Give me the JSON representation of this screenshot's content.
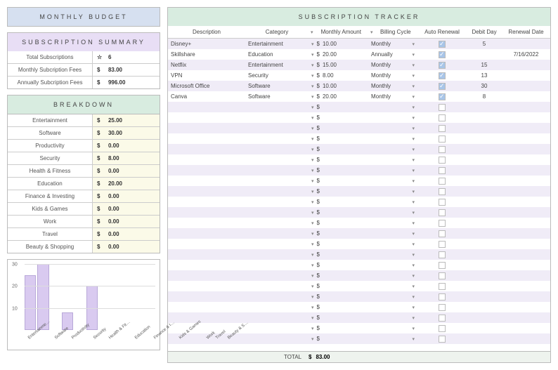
{
  "titles": {
    "budget": "MONTHLY BUDGET",
    "summary": "SUBSCRIPTION SUMMARY",
    "breakdown": "BREAKDOWN",
    "tracker": "SUBSCRIPTION TRACKER"
  },
  "summary": {
    "rows": [
      {
        "label": "Total Subscriptions",
        "currency": "☆",
        "value": "6"
      },
      {
        "label": "Monthly Subcription Fees",
        "currency": "$",
        "value": "83.00"
      },
      {
        "label": "Annually Subcription Fees",
        "currency": "$",
        "value": "996.00"
      }
    ]
  },
  "breakdown": {
    "rows": [
      {
        "label": "Entertainment",
        "value": "25.00"
      },
      {
        "label": "Software",
        "value": "30.00"
      },
      {
        "label": "Productivity",
        "value": "0.00"
      },
      {
        "label": "Security",
        "value": "8.00"
      },
      {
        "label": "Health & Fitness",
        "value": "0.00"
      },
      {
        "label": "Education",
        "value": "20.00"
      },
      {
        "label": "Finance & Investing",
        "value": "0.00"
      },
      {
        "label": "Kids & Games",
        "value": "0.00"
      },
      {
        "label": "Work",
        "value": "0.00"
      },
      {
        "label": "Travel",
        "value": "0.00"
      },
      {
        "label": "Beauty & Shopping",
        "value": "0.00"
      }
    ]
  },
  "chart_data": {
    "type": "bar",
    "categories": [
      "Entertainme…",
      "Software",
      "Productivity",
      "Security",
      "Health & Fit…",
      "Education",
      "Finance & I…",
      "Kids & Games",
      "Work",
      "Travel",
      "Beauty & S…"
    ],
    "values": [
      25,
      30,
      0,
      8,
      0,
      20,
      0,
      0,
      0,
      0,
      0
    ],
    "ylim": [
      0,
      30
    ],
    "yticks": [
      10,
      20,
      30
    ],
    "title": "",
    "xlabel": "",
    "ylabel": ""
  },
  "tracker": {
    "headers": [
      "Description",
      "Category",
      "Monthly Amount",
      "Billing Cycle",
      "Auto Renewal",
      "Debit Day",
      "Renewal Date"
    ],
    "total_label": "TOTAL",
    "total_value": "83.00",
    "rows": [
      {
        "desc": "Disney+",
        "cat": "Entertainment",
        "amt": "10.00",
        "cycle": "Monthly",
        "auto": true,
        "debit": "5",
        "renew": ""
      },
      {
        "desc": "Skillshare",
        "cat": "Education",
        "amt": "20.00",
        "cycle": "Annually",
        "auto": true,
        "debit": "",
        "renew": "7/16/2022"
      },
      {
        "desc": "Netflix",
        "cat": "Entertainment",
        "amt": "15.00",
        "cycle": "Monthly",
        "auto": true,
        "debit": "15",
        "renew": ""
      },
      {
        "desc": "VPN",
        "cat": "Security",
        "amt": "8.00",
        "cycle": "Monthly",
        "auto": true,
        "debit": "13",
        "renew": ""
      },
      {
        "desc": "Microsoft Office",
        "cat": "Software",
        "amt": "10.00",
        "cycle": "Monthly",
        "auto": true,
        "debit": "30",
        "renew": ""
      },
      {
        "desc": "Canva",
        "cat": "Software",
        "amt": "20.00",
        "cycle": "Monthly",
        "auto": true,
        "debit": "8",
        "renew": ""
      },
      {
        "desc": "",
        "cat": "",
        "amt": "",
        "cycle": "",
        "auto": false,
        "debit": "",
        "renew": ""
      },
      {
        "desc": "",
        "cat": "",
        "amt": "",
        "cycle": "",
        "auto": false,
        "debit": "",
        "renew": ""
      },
      {
        "desc": "",
        "cat": "",
        "amt": "",
        "cycle": "",
        "auto": false,
        "debit": "",
        "renew": ""
      },
      {
        "desc": "",
        "cat": "",
        "amt": "",
        "cycle": "",
        "auto": false,
        "debit": "",
        "renew": ""
      },
      {
        "desc": "",
        "cat": "",
        "amt": "",
        "cycle": "",
        "auto": false,
        "debit": "",
        "renew": ""
      },
      {
        "desc": "",
        "cat": "",
        "amt": "",
        "cycle": "",
        "auto": false,
        "debit": "",
        "renew": ""
      },
      {
        "desc": "",
        "cat": "",
        "amt": "",
        "cycle": "",
        "auto": false,
        "debit": "",
        "renew": ""
      },
      {
        "desc": "",
        "cat": "",
        "amt": "",
        "cycle": "",
        "auto": false,
        "debit": "",
        "renew": ""
      },
      {
        "desc": "",
        "cat": "",
        "amt": "",
        "cycle": "",
        "auto": false,
        "debit": "",
        "renew": ""
      },
      {
        "desc": "",
        "cat": "",
        "amt": "",
        "cycle": "",
        "auto": false,
        "debit": "",
        "renew": ""
      },
      {
        "desc": "",
        "cat": "",
        "amt": "",
        "cycle": "",
        "auto": false,
        "debit": "",
        "renew": ""
      },
      {
        "desc": "",
        "cat": "",
        "amt": "",
        "cycle": "",
        "auto": false,
        "debit": "",
        "renew": ""
      },
      {
        "desc": "",
        "cat": "",
        "amt": "",
        "cycle": "",
        "auto": false,
        "debit": "",
        "renew": ""
      },
      {
        "desc": "",
        "cat": "",
        "amt": "",
        "cycle": "",
        "auto": false,
        "debit": "",
        "renew": ""
      },
      {
        "desc": "",
        "cat": "",
        "amt": "",
        "cycle": "",
        "auto": false,
        "debit": "",
        "renew": ""
      },
      {
        "desc": "",
        "cat": "",
        "amt": "",
        "cycle": "",
        "auto": false,
        "debit": "",
        "renew": ""
      },
      {
        "desc": "",
        "cat": "",
        "amt": "",
        "cycle": "",
        "auto": false,
        "debit": "",
        "renew": ""
      },
      {
        "desc": "",
        "cat": "",
        "amt": "",
        "cycle": "",
        "auto": false,
        "debit": "",
        "renew": ""
      },
      {
        "desc": "",
        "cat": "",
        "amt": "",
        "cycle": "",
        "auto": false,
        "debit": "",
        "renew": ""
      },
      {
        "desc": "",
        "cat": "",
        "amt": "",
        "cycle": "",
        "auto": false,
        "debit": "",
        "renew": ""
      },
      {
        "desc": "",
        "cat": "",
        "amt": "",
        "cycle": "",
        "auto": false,
        "debit": "",
        "renew": ""
      },
      {
        "desc": "",
        "cat": "",
        "amt": "",
        "cycle": "",
        "auto": false,
        "debit": "",
        "renew": ""
      },
      {
        "desc": "",
        "cat": "",
        "amt": "",
        "cycle": "",
        "auto": false,
        "debit": "",
        "renew": ""
      }
    ]
  }
}
